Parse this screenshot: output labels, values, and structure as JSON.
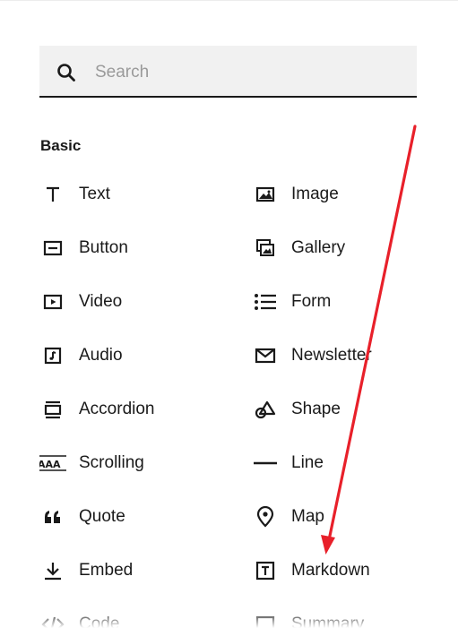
{
  "search": {
    "placeholder": "Search",
    "value": ""
  },
  "section": {
    "title": "Basic"
  },
  "blocks": {
    "left": [
      {
        "label": "Text",
        "icon": "text-icon"
      },
      {
        "label": "Button",
        "icon": "button-icon"
      },
      {
        "label": "Video",
        "icon": "video-icon"
      },
      {
        "label": "Audio",
        "icon": "audio-icon"
      },
      {
        "label": "Accordion",
        "icon": "accordion-icon"
      },
      {
        "label": "Scrolling",
        "icon": "scrolling-icon"
      },
      {
        "label": "Quote",
        "icon": "quote-icon"
      },
      {
        "label": "Embed",
        "icon": "embed-icon"
      },
      {
        "label": "Code",
        "icon": "code-icon"
      }
    ],
    "right": [
      {
        "label": "Image",
        "icon": "image-icon"
      },
      {
        "label": "Gallery",
        "icon": "gallery-icon"
      },
      {
        "label": "Form",
        "icon": "form-icon"
      },
      {
        "label": "Newsletter",
        "icon": "envelope-icon"
      },
      {
        "label": "Shape",
        "icon": "shape-icon"
      },
      {
        "label": "Line",
        "icon": "line-icon"
      },
      {
        "label": "Map",
        "icon": "map-pin-icon"
      },
      {
        "label": "Markdown",
        "icon": "markdown-icon"
      },
      {
        "label": "Summary",
        "icon": "summary-icon"
      }
    ]
  },
  "annotation": {
    "color": "#e8202a",
    "target": "Markdown"
  }
}
